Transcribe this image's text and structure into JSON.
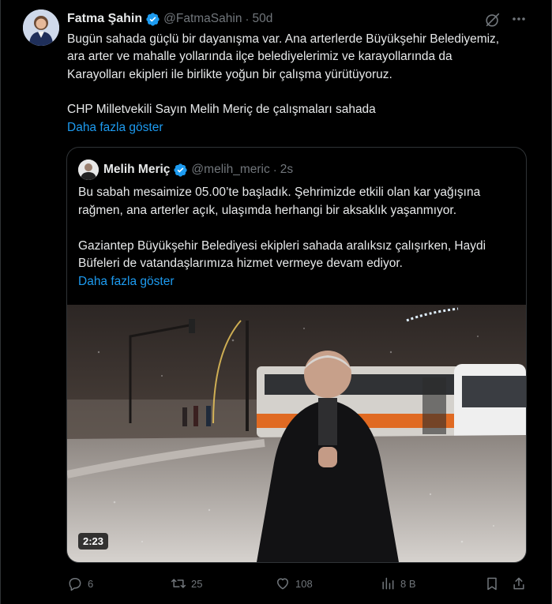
{
  "post": {
    "author_name": "Fatma Şahin",
    "author_handle": "@FatmaSahin",
    "separator": "·",
    "age": "50d",
    "text_lines": [
      "Bugün sahada güçlü bir dayanışma var. Ana arterlerde Büyükşehir Belediyemiz,",
      "ara arter ve mahalle yollarında ilçe belediyelerimiz ve karayollarında da",
      "Karayolları ekipleri ile birlikte yoğun bir çalışma yürütüyoruz.",
      "CHP Milletvekili Sayın Melih Meriç de çalışmaları sahada"
    ],
    "show_more": "Daha fazla göster"
  },
  "quote": {
    "author_name": "Melih Meriç",
    "author_handle": "@melih_meric",
    "separator": "·",
    "age": "2s",
    "text_lines": [
      "Bu sabah mesaimize 05.00’te başladık. Şehrimizde etkili olan kar yağışına",
      "rağmen, ana arterler açık, ulaşımda herhangi bir aksaklık yaşanmıyor.",
      "Gaziantep Büyükşehir Belediyesi ekipleri sahada aralıksız çalışırken, Haydi",
      "Büfeleri de vatandaşlarımıza hizmet vermeye devam ediyor."
    ],
    "show_more": "Daha fazla göster",
    "video_duration": "2:23"
  },
  "actions": {
    "replies": "6",
    "reposts": "25",
    "likes": "108",
    "views": "8 B"
  },
  "colors": {
    "background": "#000000",
    "text": "#e7e9ea",
    "muted": "#71767b",
    "link": "#1d9bf0",
    "border": "#2f3336",
    "verified": "#1d9bf0"
  },
  "icons": [
    "verified-badge-icon",
    "grok-icon",
    "more-icon",
    "reply-icon",
    "repost-icon",
    "like-icon",
    "views-icon",
    "bookmark-icon",
    "share-icon"
  ]
}
